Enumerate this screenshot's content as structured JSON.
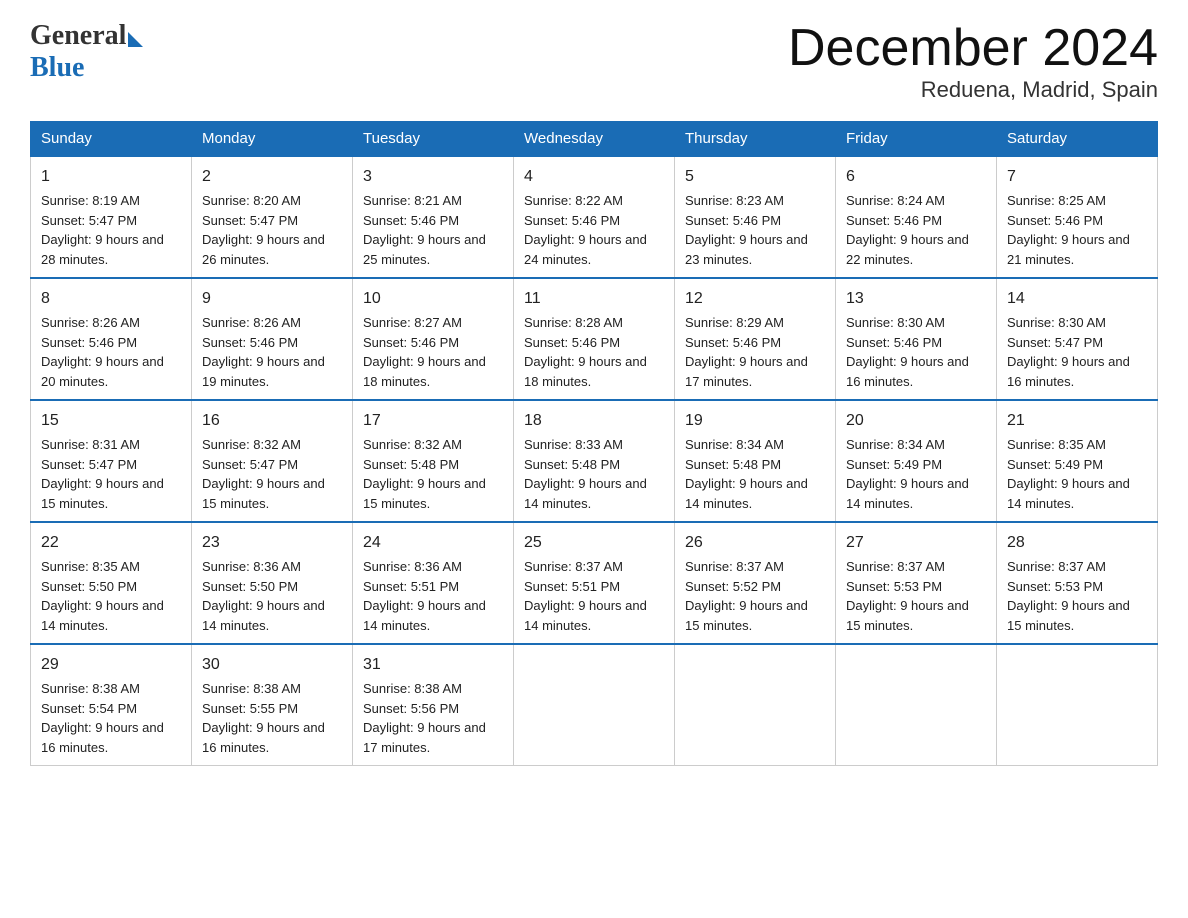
{
  "header": {
    "logo_general": "General",
    "logo_blue": "Blue",
    "title": "December 2024",
    "subtitle": "Reduena, Madrid, Spain"
  },
  "calendar": {
    "days_of_week": [
      "Sunday",
      "Monday",
      "Tuesday",
      "Wednesday",
      "Thursday",
      "Friday",
      "Saturday"
    ],
    "weeks": [
      [
        {
          "day": "1",
          "sunrise": "8:19 AM",
          "sunset": "5:47 PM",
          "daylight": "9 hours and 28 minutes."
        },
        {
          "day": "2",
          "sunrise": "8:20 AM",
          "sunset": "5:47 PM",
          "daylight": "9 hours and 26 minutes."
        },
        {
          "day": "3",
          "sunrise": "8:21 AM",
          "sunset": "5:46 PM",
          "daylight": "9 hours and 25 minutes."
        },
        {
          "day": "4",
          "sunrise": "8:22 AM",
          "sunset": "5:46 PM",
          "daylight": "9 hours and 24 minutes."
        },
        {
          "day": "5",
          "sunrise": "8:23 AM",
          "sunset": "5:46 PM",
          "daylight": "9 hours and 23 minutes."
        },
        {
          "day": "6",
          "sunrise": "8:24 AM",
          "sunset": "5:46 PM",
          "daylight": "9 hours and 22 minutes."
        },
        {
          "day": "7",
          "sunrise": "8:25 AM",
          "sunset": "5:46 PM",
          "daylight": "9 hours and 21 minutes."
        }
      ],
      [
        {
          "day": "8",
          "sunrise": "8:26 AM",
          "sunset": "5:46 PM",
          "daylight": "9 hours and 20 minutes."
        },
        {
          "day": "9",
          "sunrise": "8:26 AM",
          "sunset": "5:46 PM",
          "daylight": "9 hours and 19 minutes."
        },
        {
          "day": "10",
          "sunrise": "8:27 AM",
          "sunset": "5:46 PM",
          "daylight": "9 hours and 18 minutes."
        },
        {
          "day": "11",
          "sunrise": "8:28 AM",
          "sunset": "5:46 PM",
          "daylight": "9 hours and 18 minutes."
        },
        {
          "day": "12",
          "sunrise": "8:29 AM",
          "sunset": "5:46 PM",
          "daylight": "9 hours and 17 minutes."
        },
        {
          "day": "13",
          "sunrise": "8:30 AM",
          "sunset": "5:46 PM",
          "daylight": "9 hours and 16 minutes."
        },
        {
          "day": "14",
          "sunrise": "8:30 AM",
          "sunset": "5:47 PM",
          "daylight": "9 hours and 16 minutes."
        }
      ],
      [
        {
          "day": "15",
          "sunrise": "8:31 AM",
          "sunset": "5:47 PM",
          "daylight": "9 hours and 15 minutes."
        },
        {
          "day": "16",
          "sunrise": "8:32 AM",
          "sunset": "5:47 PM",
          "daylight": "9 hours and 15 minutes."
        },
        {
          "day": "17",
          "sunrise": "8:32 AM",
          "sunset": "5:48 PM",
          "daylight": "9 hours and 15 minutes."
        },
        {
          "day": "18",
          "sunrise": "8:33 AM",
          "sunset": "5:48 PM",
          "daylight": "9 hours and 14 minutes."
        },
        {
          "day": "19",
          "sunrise": "8:34 AM",
          "sunset": "5:48 PM",
          "daylight": "9 hours and 14 minutes."
        },
        {
          "day": "20",
          "sunrise": "8:34 AM",
          "sunset": "5:49 PM",
          "daylight": "9 hours and 14 minutes."
        },
        {
          "day": "21",
          "sunrise": "8:35 AM",
          "sunset": "5:49 PM",
          "daylight": "9 hours and 14 minutes."
        }
      ],
      [
        {
          "day": "22",
          "sunrise": "8:35 AM",
          "sunset": "5:50 PM",
          "daylight": "9 hours and 14 minutes."
        },
        {
          "day": "23",
          "sunrise": "8:36 AM",
          "sunset": "5:50 PM",
          "daylight": "9 hours and 14 minutes."
        },
        {
          "day": "24",
          "sunrise": "8:36 AM",
          "sunset": "5:51 PM",
          "daylight": "9 hours and 14 minutes."
        },
        {
          "day": "25",
          "sunrise": "8:37 AM",
          "sunset": "5:51 PM",
          "daylight": "9 hours and 14 minutes."
        },
        {
          "day": "26",
          "sunrise": "8:37 AM",
          "sunset": "5:52 PM",
          "daylight": "9 hours and 15 minutes."
        },
        {
          "day": "27",
          "sunrise": "8:37 AM",
          "sunset": "5:53 PM",
          "daylight": "9 hours and 15 minutes."
        },
        {
          "day": "28",
          "sunrise": "8:37 AM",
          "sunset": "5:53 PM",
          "daylight": "9 hours and 15 minutes."
        }
      ],
      [
        {
          "day": "29",
          "sunrise": "8:38 AM",
          "sunset": "5:54 PM",
          "daylight": "9 hours and 16 minutes."
        },
        {
          "day": "30",
          "sunrise": "8:38 AM",
          "sunset": "5:55 PM",
          "daylight": "9 hours and 16 minutes."
        },
        {
          "day": "31",
          "sunrise": "8:38 AM",
          "sunset": "5:56 PM",
          "daylight": "9 hours and 17 minutes."
        },
        null,
        null,
        null,
        null
      ]
    ],
    "sunrise_label": "Sunrise: ",
    "sunset_label": "Sunset: ",
    "daylight_label": "Daylight: "
  }
}
